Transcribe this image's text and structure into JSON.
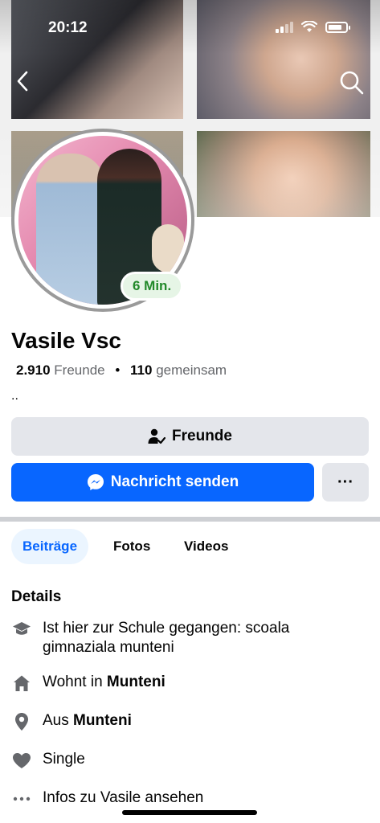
{
  "status_bar": {
    "time": "20:12"
  },
  "profile": {
    "name": "Vasile Vsc",
    "active_badge": "6 Min.",
    "friends_count": "2.910",
    "friends_label": "Freunde",
    "mutual_count": "110",
    "mutual_label": "gemeinsam",
    "separator": "•",
    "bio": ".."
  },
  "actions": {
    "friends_label": "Freunde",
    "message_label": "Nachricht senden",
    "more_label": "···"
  },
  "tabs": [
    {
      "label": "Beiträge",
      "active": true
    },
    {
      "label": "Fotos",
      "active": false
    },
    {
      "label": "Videos",
      "active": false
    }
  ],
  "details": {
    "title": "Details",
    "items": [
      {
        "icon": "graduation-cap-icon",
        "text": "Ist hier zur Schule gegangen: scoala gimnaziala munteni",
        "bold": ""
      },
      {
        "icon": "home-icon",
        "text": "Wohnt in ",
        "bold": "Munteni"
      },
      {
        "icon": "location-pin-icon",
        "text": "Aus ",
        "bold": "Munteni"
      },
      {
        "icon": "heart-icon",
        "text": "Single",
        "bold": ""
      },
      {
        "icon": "more-dots-icon",
        "text": "Infos zu Vasile ansehen",
        "bold": ""
      }
    ]
  },
  "colors": {
    "brand_blue": "#0866ff",
    "online_green": "#238a2b",
    "button_gray": "#e4e6eb"
  }
}
